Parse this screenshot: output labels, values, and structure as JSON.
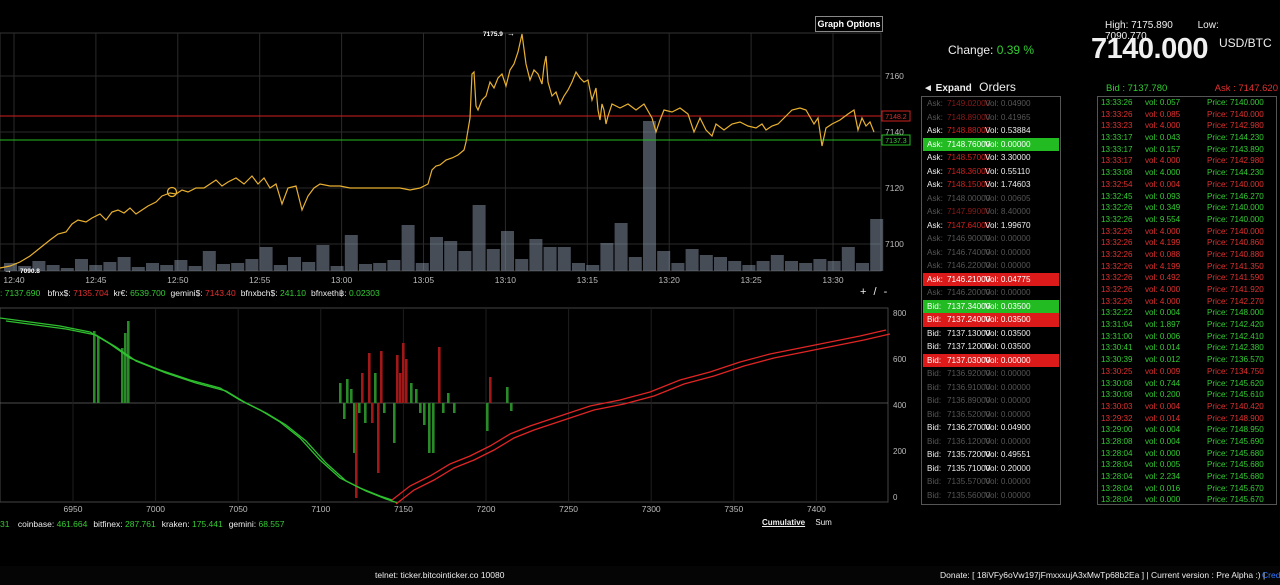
{
  "header": {
    "graph_options": "Graph Options",
    "high_label": "High: 7175.890",
    "low_label": "Low: 7090.770",
    "change_label": "Change:",
    "change_value": "0.39 %",
    "price": "7140.000",
    "price_unit": "USD/BTC"
  },
  "price_chart": {
    "time_ticks": [
      "12:40",
      "12:45",
      "12:50",
      "12:55",
      "13:00",
      "13:05",
      "13:10",
      "13:15",
      "13:20",
      "13:25",
      "13:30"
    ],
    "price_ticks": [
      "7160",
      "7140",
      "7120",
      "7100"
    ],
    "high_marker": "7175.9",
    "low_marker": "7090.8",
    "ask_line_label": "7148.2",
    "bid_line_label": "7137.3",
    "line_color": "#e8b030"
  },
  "exchange_ticker": {
    "prefix": ": 7137.690",
    "items": [
      {
        "name": "bfnx$:",
        "value": "7135.704",
        "color": "red"
      },
      {
        "name": "kr€:",
        "value": "6539.700",
        "color": "green"
      },
      {
        "name": "gemini$:",
        "value": "7143.40",
        "color": "red"
      },
      {
        "name": "bfnxbch$:",
        "value": "241.10",
        "color": "green"
      },
      {
        "name": "bfnxeth฿:",
        "value": "0.02303",
        "color": "green"
      }
    ]
  },
  "depth_chart": {
    "zoom_label": "+ / -",
    "price_ticks": [
      "6950",
      "7000",
      "7050",
      "7100",
      "7150",
      "7200",
      "7250",
      "7300",
      "7350",
      "7400"
    ],
    "volume_ticks": [
      "800",
      "600",
      "400",
      "200",
      "0"
    ]
  },
  "volume_ticker": {
    "prefix": "31",
    "items": [
      {
        "name": "coinbase:",
        "value": "461.664"
      },
      {
        "name": "bitfinex:",
        "value": "287.761"
      },
      {
        "name": "kraken:",
        "value": "175.441"
      },
      {
        "name": "gemini:",
        "value": "68.557"
      }
    ]
  },
  "depth_controls": {
    "cumulative": "Cumulative",
    "sum": "Sum"
  },
  "orders": {
    "expand_label": "◄ Expand",
    "title": "Orders",
    "rows": [
      {
        "label": "Ask:",
        "price": "7149.02000",
        "vol": "Vol: 0.04900",
        "style": "ask-dim"
      },
      {
        "label": "Ask:",
        "price": "7148.89000",
        "vol": "Vol: 0.41965",
        "style": "ask-dim"
      },
      {
        "label": "Ask:",
        "price": "7148.88000",
        "vol": "Vol: 0.53884",
        "style": "ask"
      },
      {
        "label": "Ask:",
        "price": "7148.76000",
        "vol": "Vol: 0.00000",
        "style": "hl-green"
      },
      {
        "label": "Ask:",
        "price": "7148.57000",
        "vol": "Vol: 3.30000",
        "style": "ask"
      },
      {
        "label": "Ask:",
        "price": "7148.36000",
        "vol": "Vol: 0.55110",
        "style": "ask"
      },
      {
        "label": "Ask:",
        "price": "7148.15000",
        "vol": "Vol: 1.74603",
        "style": "ask"
      },
      {
        "label": "Ask:",
        "price": "7148.00000",
        "vol": "Vol: 0.00605",
        "style": "dim"
      },
      {
        "label": "Ask:",
        "price": "7147.99000",
        "vol": "Vol: 8.40000",
        "style": "ask-dim"
      },
      {
        "label": "Ask:",
        "price": "7147.64000",
        "vol": "Vol: 1.99670",
        "style": "ask"
      },
      {
        "label": "Ask:",
        "price": "7146.90000",
        "vol": "Vol: 0.00000",
        "style": "dim"
      },
      {
        "label": "Ask:",
        "price": "7146.74000",
        "vol": "Vol: 0.00000",
        "style": "dim"
      },
      {
        "label": "Ask:",
        "price": "7146.22000",
        "vol": "Vol: 0.00000",
        "style": "dim"
      },
      {
        "label": "Ask:",
        "price": "7146.21000",
        "vol": "Vol: 0.04775",
        "style": "hl-red"
      },
      {
        "label": "Ask:",
        "price": "7146.20000",
        "vol": "Vol: 0.00000",
        "style": "dim"
      },
      {
        "label": "Bid:",
        "price": "7137.34000",
        "vol": "Vol: 0.03500",
        "style": "hl-green"
      },
      {
        "label": "Bid:",
        "price": "7137.24000",
        "vol": "Vol: 0.03500",
        "style": "hl-red"
      },
      {
        "label": "Bid:",
        "price": "7137.13000",
        "vol": "Vol: 0.03500",
        "style": "bid"
      },
      {
        "label": "Bid:",
        "price": "7137.12000",
        "vol": "Vol: 0.03500",
        "style": "bid"
      },
      {
        "label": "Bid:",
        "price": "7137.03000",
        "vol": "Vol: 0.00000",
        "style": "hl-red"
      },
      {
        "label": "Bid:",
        "price": "7136.92000",
        "vol": "Vol: 0.00000",
        "style": "dim"
      },
      {
        "label": "Bid:",
        "price": "7136.91000",
        "vol": "Vol: 0.00000",
        "style": "dim"
      },
      {
        "label": "Bid:",
        "price": "7136.89000",
        "vol": "Vol: 0.00000",
        "style": "dim"
      },
      {
        "label": "Bid:",
        "price": "7136.52000",
        "vol": "Vol: 0.00000",
        "style": "dim"
      },
      {
        "label": "Bid:",
        "price": "7136.27000",
        "vol": "Vol: 0.04900",
        "style": "bid"
      },
      {
        "label": "Bid:",
        "price": "7136.12000",
        "vol": "Vol: 0.00000",
        "style": "dim"
      },
      {
        "label": "Bid:",
        "price": "7135.72000",
        "vol": "Vol: 0.49551",
        "style": "bid"
      },
      {
        "label": "Bid:",
        "price": "7135.71000",
        "vol": "Vol: 0.20000",
        "style": "bid"
      },
      {
        "label": "Bid:",
        "price": "7135.57000",
        "vol": "Vol: 0.00000",
        "style": "dim"
      },
      {
        "label": "Bid:",
        "price": "7135.56000",
        "vol": "Vol: 0.00000",
        "style": "dim"
      }
    ]
  },
  "bidask": {
    "bid": "Bid : 7137.780",
    "ask": "Ask : 7147.620"
  },
  "trades": [
    {
      "time": "13:33:26",
      "vol": "vol: 0.057",
      "price": "Price: 7140.000",
      "side": "buy"
    },
    {
      "time": "13:33:26",
      "vol": "vol: 0.085",
      "price": "Price: 7140.000",
      "side": "sell"
    },
    {
      "time": "13:33:23",
      "vol": "vol: 4.000",
      "price": "Price: 7142.980",
      "side": "sell"
    },
    {
      "time": "13:33:17",
      "vol": "vol: 0.043",
      "price": "Price: 7144.230",
      "side": "buy"
    },
    {
      "time": "13:33:17",
      "vol": "vol: 0.157",
      "price": "Price: 7143.890",
      "side": "buy"
    },
    {
      "time": "13:33:17",
      "vol": "vol: 4.000",
      "price": "Price: 7142.980",
      "side": "sell"
    },
    {
      "time": "13:33:08",
      "vol": "vol: 4.000",
      "price": "Price: 7144.230",
      "side": "buy"
    },
    {
      "time": "13:32:54",
      "vol": "vol: 0.004",
      "price": "Price: 7140.000",
      "side": "sell"
    },
    {
      "time": "13:32:45",
      "vol": "vol: 0.093",
      "price": "Price: 7146.270",
      "side": "buy"
    },
    {
      "time": "13:32:26",
      "vol": "vol: 0.349",
      "price": "Price: 7140.000",
      "side": "buy"
    },
    {
      "time": "13:32:26",
      "vol": "vol: 9.554",
      "price": "Price: 7140.000",
      "side": "buy"
    },
    {
      "time": "13:32:26",
      "vol": "vol: 4.000",
      "price": "Price: 7140.000",
      "side": "sell"
    },
    {
      "time": "13:32:26",
      "vol": "vol: 4.199",
      "price": "Price: 7140.860",
      "side": "sell"
    },
    {
      "time": "13:32:26",
      "vol": "vol: 0.088",
      "price": "Price: 7140.880",
      "side": "sell"
    },
    {
      "time": "13:32:26",
      "vol": "vol: 4.199",
      "price": "Price: 7141.350",
      "side": "sell"
    },
    {
      "time": "13:32:26",
      "vol": "vol: 0.492",
      "price": "Price: 7141.590",
      "side": "sell"
    },
    {
      "time": "13:32:26",
      "vol": "vol: 4.000",
      "price": "Price: 7141.920",
      "side": "sell"
    },
    {
      "time": "13:32:26",
      "vol": "vol: 4.000",
      "price": "Price: 7142.270",
      "side": "sell"
    },
    {
      "time": "13:32:22",
      "vol": "vol: 0.004",
      "price": "Price: 7148.000",
      "side": "buy"
    },
    {
      "time": "13:31:04",
      "vol": "vol: 1.897",
      "price": "Price: 7142.420",
      "side": "buy"
    },
    {
      "time": "13:31:00",
      "vol": "vol: 0.006",
      "price": "Price: 7142.410",
      "side": "buy"
    },
    {
      "time": "13:30:41",
      "vol": "vol: 0.014",
      "price": "Price: 7142.380",
      "side": "buy"
    },
    {
      "time": "13:30:39",
      "vol": "vol: 0.012",
      "price": "Price: 7136.570",
      "side": "buy"
    },
    {
      "time": "13:30:25",
      "vol": "vol: 0.009",
      "price": "Price: 7134.750",
      "side": "sell"
    },
    {
      "time": "13:30:08",
      "vol": "vol: 0.744",
      "price": "Price: 7145.620",
      "side": "buy"
    },
    {
      "time": "13:30:08",
      "vol": "vol: 0.200",
      "price": "Price: 7145.610",
      "side": "buy"
    },
    {
      "time": "13:30:03",
      "vol": "vol: 0.004",
      "price": "Price: 7140.420",
      "side": "sell"
    },
    {
      "time": "13:29:32",
      "vol": "vol: 0.014",
      "price": "Price: 7148.900",
      "side": "sell"
    },
    {
      "time": "13:29:00",
      "vol": "vol: 0.004",
      "price": "Price: 7148.950",
      "side": "buy"
    },
    {
      "time": "13:28:08",
      "vol": "vol: 0.004",
      "price": "Price: 7145.690",
      "side": "buy"
    },
    {
      "time": "13:28:04",
      "vol": "vol: 0.000",
      "price": "Price: 7145.680",
      "side": "buy"
    },
    {
      "time": "13:28:04",
      "vol": "vol: 0.005",
      "price": "Price: 7145.680",
      "side": "buy"
    },
    {
      "time": "13:28:04",
      "vol": "vol: 2.234",
      "price": "Price: 7145.680",
      "side": "buy"
    },
    {
      "time": "13:28:04",
      "vol": "vol: 0.016",
      "price": "Price: 7145.670",
      "side": "buy"
    },
    {
      "time": "13:28:04",
      "vol": "vol: 0.000",
      "price": "Price: 7145.670",
      "side": "buy"
    }
  ],
  "footer": {
    "telnet": "telnet: ticker.bitcointicker.co 10080",
    "donate": "Donate: [ 18iVFy6oVw197jFmxxxujA3xMwTp68b2Ea ] | Current version : Pre Alpha :) |",
    "cred": "Cred"
  }
}
